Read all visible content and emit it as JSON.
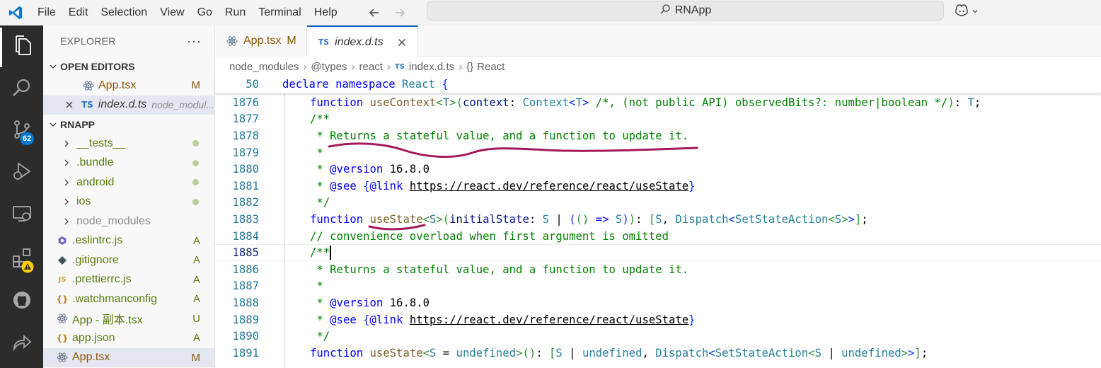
{
  "menu": [
    "File",
    "Edit",
    "Selection",
    "View",
    "Go",
    "Run",
    "Terminal",
    "Help"
  ],
  "command_center": {
    "text": "RNApp"
  },
  "activity": {
    "scm_badge": "62"
  },
  "sidebar": {
    "title": "EXPLORER",
    "more": "···",
    "open_editors_title": "OPEN EDITORS",
    "open_editors": [
      {
        "name": "App.tsx",
        "status": "M"
      },
      {
        "name": "index.d.ts",
        "path": "node_modul..."
      }
    ],
    "project_title": "RNAPP",
    "files": [
      {
        "name": "__tests__",
        "kind": "folder"
      },
      {
        "name": ".bundle",
        "kind": "folder"
      },
      {
        "name": "android",
        "kind": "folder"
      },
      {
        "name": "ios",
        "kind": "folder"
      },
      {
        "name": "node_modules",
        "kind": "folder"
      },
      {
        "name": ".eslintrc.js",
        "status": "A"
      },
      {
        "name": ".gitignore",
        "status": "A"
      },
      {
        "name": ".prettierrc.js",
        "status": "A"
      },
      {
        "name": ".watchmanconfig",
        "status": "A"
      },
      {
        "name": "App - 副本.tsx",
        "status": "U"
      },
      {
        "name": "app.json",
        "status": "A"
      },
      {
        "name": "App.tsx",
        "status": "M"
      }
    ]
  },
  "tabs": [
    {
      "label": "App.tsx",
      "tag": "M",
      "active": false
    },
    {
      "label": "index.d.ts",
      "icon": "TS",
      "active": true
    }
  ],
  "breadcrumb": [
    "node_modules",
    "@types",
    "react",
    "index.d.ts",
    "React"
  ],
  "editor": {
    "sticky_line_number": "50",
    "sticky_text": "declare namespace React {",
    "line_numbers": [
      "1876",
      "1877",
      "1878",
      "1879",
      "1880",
      "1881",
      "1882",
      "1883",
      "1884",
      "1885",
      "1886",
      "1887",
      "1888",
      "1889",
      "1890",
      "1891"
    ],
    "lines": [
      "function useContext<T>(context: Context<T> /*, (not public API) observedBits?: number|boolean */): T;",
      "/**",
      " * Returns a stateful value, and a function to update it.",
      " *",
      " * @version 16.8.0",
      " * @see {@link https://react.dev/reference/react/useState}",
      " */",
      "function useState<S>(initialState: S | (() => S)): [S, Dispatch<SetStateAction<S>>];",
      "// convenience overload when first argument is omitted",
      "/**",
      " * Returns a stateful value, and a function to update it.",
      " *",
      " * @version 16.8.0",
      " * @see {@link https://react.dev/reference/react/useState}",
      " */",
      "function useState<S = undefined>(): [S | undefined, Dispatch<SetStateAction<S | undefined>>];"
    ]
  },
  "colors": {
    "activity_bar": "#2c2c2c",
    "accent": "#005fb8",
    "annotation": "#a3195b",
    "line_number": "#237893"
  }
}
